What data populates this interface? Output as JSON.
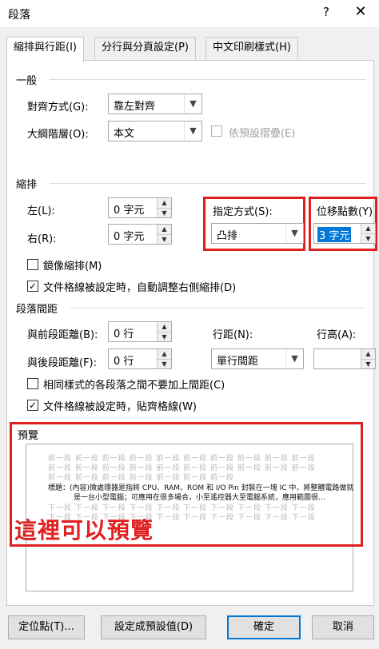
{
  "window": {
    "title": "段落",
    "help": "?",
    "close": "✕"
  },
  "tabs": [
    {
      "label": "縮排與行距(I)"
    },
    {
      "label": "分行與分頁設定(P)"
    },
    {
      "label": "中文印刷樣式(H)"
    }
  ],
  "general": {
    "section": "一般",
    "alignment_label": "對齊方式(G):",
    "alignment_value": "靠左對齊",
    "outline_label": "大綱階層(O):",
    "outline_value": "本文",
    "collapse_label": "依預設摺疊(E)"
  },
  "indent": {
    "section": "縮排",
    "left_label": "左(L):",
    "left_value": "0 字元",
    "right_label": "右(R):",
    "right_value": "0 字元",
    "special_label": "指定方式(S):",
    "special_value": "凸排",
    "by_label": "位移點數(Y)",
    "by_value": "3 字元",
    "mirror_label": "鏡像縮排(M)",
    "grid_label": "文件格線被設定時，自動調整右側縮排(D)"
  },
  "spacing": {
    "section": "段落間距",
    "before_label": "與前段距離(B):",
    "before_value": "0 行",
    "after_label": "與後段距離(F):",
    "after_value": "0 行",
    "line_label": "行距(N):",
    "line_value": "單行間距",
    "at_label": "行高(A):",
    "at_value": "",
    "nospace_label": "相同樣式的各段落之間不要加上間距(C)",
    "snap_label": "文件格線被設定時，貼齊格線(W)"
  },
  "preview": {
    "section": "預覽",
    "ghost_prev_1": "前一段 前一段 前一段 前一段 前一段 前一段 前一段 前一段 前一段 前一段",
    "ghost_prev_2": "前一段 前一段 前一段 前一段 前一段 前一段 前一段 前一段 前一段 前一段",
    "ghost_prev_3": "前一段 前一段 前一段 前一段 前一段 前一段 前一段",
    "sample_1": "標題：(內容)微處理器是指將 CPU、RAM、ROM 和 I/O Pin 封裝在一塊 IC 中，將整體電路做就",
    "sample_2": "是一台小型電腦；可應用在很多場合，小至遙控器大至電腦系統，應用範圍很…",
    "ghost_next_1": "下一段 下一段 下一段 下一段 下一段 下一段 下一段 下一段 下一段 下一段",
    "ghost_next_2": "下一段 下一段 下一段 下一段 下一段 下一段 下一段 下一段 下一段 下一段",
    "annotation": "這裡可以預覽"
  },
  "buttons": {
    "tabs": "定位點(T)...",
    "set_default": "設定成預設值(D)",
    "ok": "確定",
    "cancel": "取消"
  },
  "colors": {
    "highlight": "#e02020",
    "selection": "#0078d7"
  }
}
